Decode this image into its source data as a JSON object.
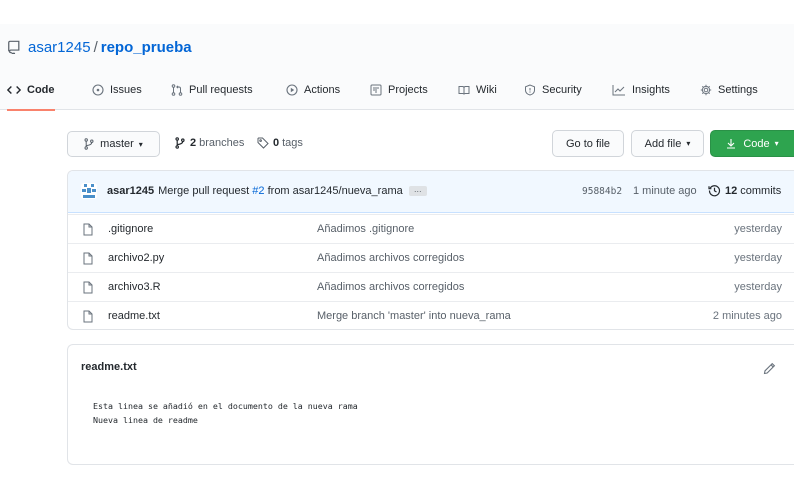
{
  "repo": {
    "owner": "asar1245",
    "separator": "/",
    "name": "repo_prueba"
  },
  "tabs": [
    {
      "label": "Code"
    },
    {
      "label": "Issues"
    },
    {
      "label": "Pull requests"
    },
    {
      "label": "Actions"
    },
    {
      "label": "Projects"
    },
    {
      "label": "Wiki"
    },
    {
      "label": "Security"
    },
    {
      "label": "Insights"
    },
    {
      "label": "Settings"
    }
  ],
  "toolbar": {
    "branch": "master",
    "branches_count": "2",
    "branches_label": "branches",
    "tags_count": "0",
    "tags_label": "tags",
    "goto_file": "Go to file",
    "add_file": "Add file",
    "code": "Code"
  },
  "latest_commit": {
    "author": "asar1245",
    "message_prefix": "Merge pull request",
    "pr": "#2",
    "message_suffix": "from asar1245/nueva_rama",
    "ellipsis": "…",
    "sha": "95884b2",
    "time": "1 minute ago",
    "commits_count": "12",
    "commits_label": "commits"
  },
  "files": [
    {
      "name": ".gitignore",
      "message": "Añadimos .gitignore",
      "age": "yesterday"
    },
    {
      "name": "archivo2.py",
      "message": "Añadimos archivos corregidos",
      "age": "yesterday"
    },
    {
      "name": "archivo3.R",
      "message": "Añadimos archivos corregidos",
      "age": "yesterday"
    },
    {
      "name": "readme.txt",
      "message": "Merge branch 'master' into nueva_rama",
      "age": "2 minutes ago"
    }
  ],
  "readme": {
    "title": "readme.txt",
    "lines": [
      "Esta linea se añadió en el documento de la nueva rama",
      "Nueva linea de readme"
    ]
  },
  "colors": {
    "accent_link": "#0366d6",
    "tab_underline": "#f9826c",
    "code_button": "#2ea44f",
    "commit_bar": "#f1f8ff"
  }
}
